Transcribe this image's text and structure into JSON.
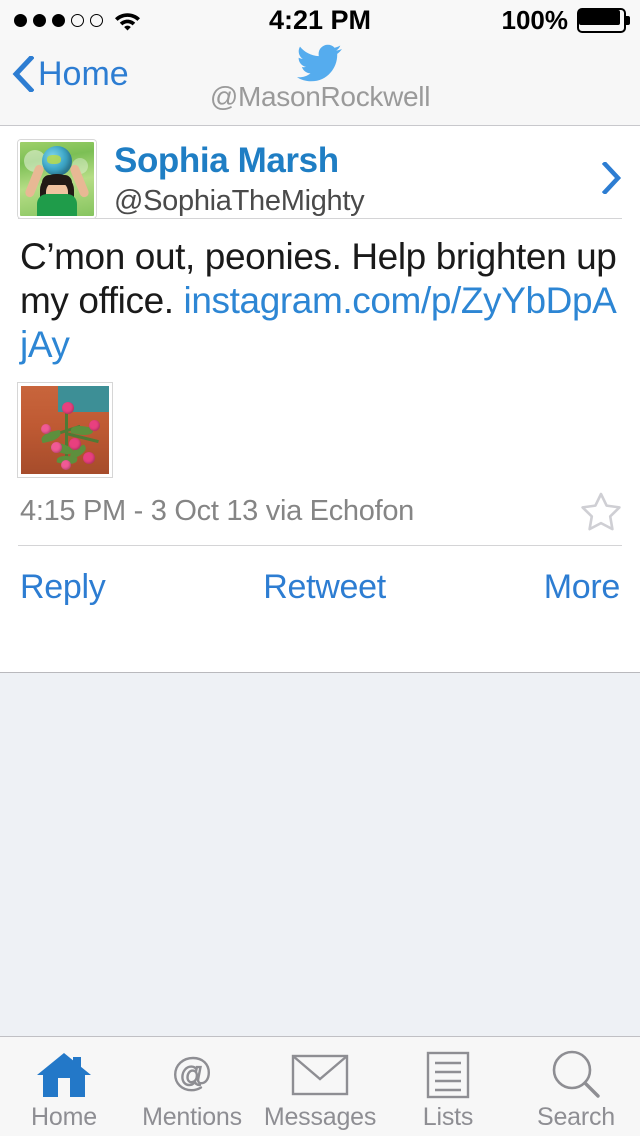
{
  "status_bar": {
    "signal_dots_filled": 3,
    "signal_dots_total": 5,
    "wifi_icon": "wifi-icon",
    "time": "4:21 PM",
    "battery_percent": "100%",
    "battery_icon": "battery-full-icon"
  },
  "nav_bar": {
    "back_icon": "chevron-left-icon",
    "back_label": "Home",
    "logo_icon": "twitter-bird-icon",
    "logo_color": "#55acee",
    "account_handle": "@MasonRockwell"
  },
  "tweet": {
    "author": {
      "avatar_icon": "user-avatar",
      "display_name": "Sophia Marsh",
      "handle": "@SophiaTheMighty",
      "disclosure_icon": "chevron-right-icon"
    },
    "text": "C’mon out, peonies. Help brighten up my office.",
    "link": "instagram.com/p/ZyYbDpAjAy",
    "media_icon": "peony-photo-thumbnail",
    "meta": "4:15 PM - 3 Oct 13 via Echofon",
    "favorite_icon": "star-outline-icon",
    "actions": [
      {
        "label": "Reply",
        "name": "reply-button"
      },
      {
        "label": "Retweet",
        "name": "retweet-button"
      },
      {
        "label": "More",
        "name": "more-button"
      }
    ]
  },
  "tab_bar": {
    "active_index": 0,
    "active_color": "#2378c8",
    "inactive_color": "#8e8e93",
    "tabs": [
      {
        "label": "Home",
        "icon": "home-icon"
      },
      {
        "label": "Mentions",
        "icon": "at-sign-icon"
      },
      {
        "label": "Messages",
        "icon": "envelope-icon"
      },
      {
        "label": "Lists",
        "icon": "lists-icon"
      },
      {
        "label": "Search",
        "icon": "magnifier-icon"
      }
    ]
  },
  "colors": {
    "link_blue": "#2d86d4",
    "action_blue": "#2d7dd2",
    "name_blue": "#1f7ec4",
    "twitter_blue": "#55acee",
    "page_bg": "#eef1f5",
    "card_bg": "#ffffff",
    "bar_bg": "#f7f7f7"
  }
}
